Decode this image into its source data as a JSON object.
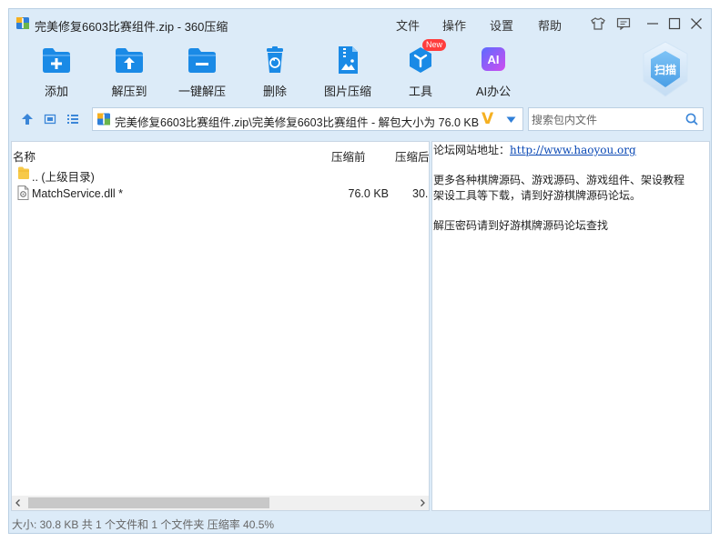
{
  "window": {
    "title": "完美修复6603比赛组件.zip - 360压缩"
  },
  "menu": [
    "文件",
    "操作",
    "设置",
    "帮助"
  ],
  "toolbar": [
    {
      "label": "添加",
      "icon": "add-folder-icon"
    },
    {
      "label": "解压到",
      "icon": "extract-to-icon"
    },
    {
      "label": "一键解压",
      "icon": "one-click-extract-icon"
    },
    {
      "label": "删除",
      "icon": "trash-icon"
    },
    {
      "label": "图片压缩",
      "icon": "image-compress-icon"
    },
    {
      "label": "工具",
      "icon": "tools-icon",
      "badge": "New"
    },
    {
      "label": "AI办公",
      "icon": "ai-office-icon",
      "icon_text": "AI"
    }
  ],
  "scan": {
    "label": "扫描"
  },
  "address": {
    "path": "完美修复6603比赛组件.zip\\完美修复6603比赛组件 - 解包大小为 76.0 KB",
    "mark": "V"
  },
  "search": {
    "placeholder": "搜索包内文件"
  },
  "columns": [
    "名称",
    "压缩前",
    "压缩后"
  ],
  "files": [
    {
      "name": ".. (上级目录)",
      "type": "parent-folder",
      "size": "",
      "packed": ""
    },
    {
      "name": "MatchService.dll *",
      "type": "dll",
      "size": "76.0 KB",
      "packed": "30."
    }
  ],
  "notes": {
    "line1_label": "论坛网站地址：",
    "line1_link": "http://www.haoyou.org",
    "line2": "更多各种棋牌源码、游戏源码、游戏组件、架设教程",
    "line3": "架设工具等下载，请到好游棋牌源码论坛。",
    "line4": "解压密码请到好游棋牌源码论坛查找"
  },
  "status": "大小: 30.8 KB 共 1 个文件和 1 个文件夹 压缩率 40.5%",
  "colors": {
    "window_bg": "#dcebf8",
    "accent": "#1a8ae6",
    "badge": "#ff3d3d",
    "link": "#0b49b5"
  }
}
